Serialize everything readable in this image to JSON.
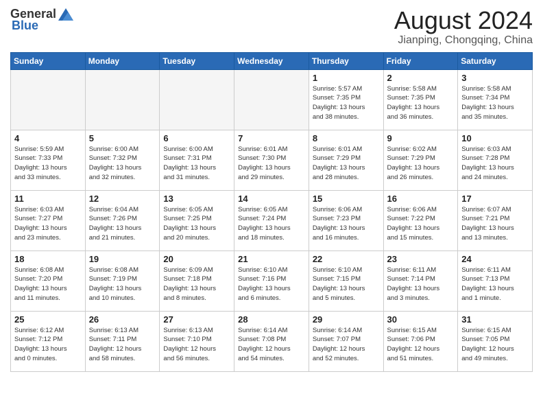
{
  "logo": {
    "general": "General",
    "blue": "Blue"
  },
  "title": "August 2024",
  "subtitle": "Jianping, Chongqing, China",
  "days_of_week": [
    "Sunday",
    "Monday",
    "Tuesday",
    "Wednesday",
    "Thursday",
    "Friday",
    "Saturday"
  ],
  "weeks": [
    [
      {
        "day": "",
        "info": ""
      },
      {
        "day": "",
        "info": ""
      },
      {
        "day": "",
        "info": ""
      },
      {
        "day": "",
        "info": ""
      },
      {
        "day": "1",
        "info": "Sunrise: 5:57 AM\nSunset: 7:35 PM\nDaylight: 13 hours\nand 38 minutes."
      },
      {
        "day": "2",
        "info": "Sunrise: 5:58 AM\nSunset: 7:35 PM\nDaylight: 13 hours\nand 36 minutes."
      },
      {
        "day": "3",
        "info": "Sunrise: 5:58 AM\nSunset: 7:34 PM\nDaylight: 13 hours\nand 35 minutes."
      }
    ],
    [
      {
        "day": "4",
        "info": "Sunrise: 5:59 AM\nSunset: 7:33 PM\nDaylight: 13 hours\nand 33 minutes."
      },
      {
        "day": "5",
        "info": "Sunrise: 6:00 AM\nSunset: 7:32 PM\nDaylight: 13 hours\nand 32 minutes."
      },
      {
        "day": "6",
        "info": "Sunrise: 6:00 AM\nSunset: 7:31 PM\nDaylight: 13 hours\nand 31 minutes."
      },
      {
        "day": "7",
        "info": "Sunrise: 6:01 AM\nSunset: 7:30 PM\nDaylight: 13 hours\nand 29 minutes."
      },
      {
        "day": "8",
        "info": "Sunrise: 6:01 AM\nSunset: 7:29 PM\nDaylight: 13 hours\nand 28 minutes."
      },
      {
        "day": "9",
        "info": "Sunrise: 6:02 AM\nSunset: 7:29 PM\nDaylight: 13 hours\nand 26 minutes."
      },
      {
        "day": "10",
        "info": "Sunrise: 6:03 AM\nSunset: 7:28 PM\nDaylight: 13 hours\nand 24 minutes."
      }
    ],
    [
      {
        "day": "11",
        "info": "Sunrise: 6:03 AM\nSunset: 7:27 PM\nDaylight: 13 hours\nand 23 minutes."
      },
      {
        "day": "12",
        "info": "Sunrise: 6:04 AM\nSunset: 7:26 PM\nDaylight: 13 hours\nand 21 minutes."
      },
      {
        "day": "13",
        "info": "Sunrise: 6:05 AM\nSunset: 7:25 PM\nDaylight: 13 hours\nand 20 minutes."
      },
      {
        "day": "14",
        "info": "Sunrise: 6:05 AM\nSunset: 7:24 PM\nDaylight: 13 hours\nand 18 minutes."
      },
      {
        "day": "15",
        "info": "Sunrise: 6:06 AM\nSunset: 7:23 PM\nDaylight: 13 hours\nand 16 minutes."
      },
      {
        "day": "16",
        "info": "Sunrise: 6:06 AM\nSunset: 7:22 PM\nDaylight: 13 hours\nand 15 minutes."
      },
      {
        "day": "17",
        "info": "Sunrise: 6:07 AM\nSunset: 7:21 PM\nDaylight: 13 hours\nand 13 minutes."
      }
    ],
    [
      {
        "day": "18",
        "info": "Sunrise: 6:08 AM\nSunset: 7:20 PM\nDaylight: 13 hours\nand 11 minutes."
      },
      {
        "day": "19",
        "info": "Sunrise: 6:08 AM\nSunset: 7:19 PM\nDaylight: 13 hours\nand 10 minutes."
      },
      {
        "day": "20",
        "info": "Sunrise: 6:09 AM\nSunset: 7:18 PM\nDaylight: 13 hours\nand 8 minutes."
      },
      {
        "day": "21",
        "info": "Sunrise: 6:10 AM\nSunset: 7:16 PM\nDaylight: 13 hours\nand 6 minutes."
      },
      {
        "day": "22",
        "info": "Sunrise: 6:10 AM\nSunset: 7:15 PM\nDaylight: 13 hours\nand 5 minutes."
      },
      {
        "day": "23",
        "info": "Sunrise: 6:11 AM\nSunset: 7:14 PM\nDaylight: 13 hours\nand 3 minutes."
      },
      {
        "day": "24",
        "info": "Sunrise: 6:11 AM\nSunset: 7:13 PM\nDaylight: 13 hours\nand 1 minute."
      }
    ],
    [
      {
        "day": "25",
        "info": "Sunrise: 6:12 AM\nSunset: 7:12 PM\nDaylight: 13 hours\nand 0 minutes."
      },
      {
        "day": "26",
        "info": "Sunrise: 6:13 AM\nSunset: 7:11 PM\nDaylight: 12 hours\nand 58 minutes."
      },
      {
        "day": "27",
        "info": "Sunrise: 6:13 AM\nSunset: 7:10 PM\nDaylight: 12 hours\nand 56 minutes."
      },
      {
        "day": "28",
        "info": "Sunrise: 6:14 AM\nSunset: 7:08 PM\nDaylight: 12 hours\nand 54 minutes."
      },
      {
        "day": "29",
        "info": "Sunrise: 6:14 AM\nSunset: 7:07 PM\nDaylight: 12 hours\nand 52 minutes."
      },
      {
        "day": "30",
        "info": "Sunrise: 6:15 AM\nSunset: 7:06 PM\nDaylight: 12 hours\nand 51 minutes."
      },
      {
        "day": "31",
        "info": "Sunrise: 6:15 AM\nSunset: 7:05 PM\nDaylight: 12 hours\nand 49 minutes."
      }
    ]
  ]
}
